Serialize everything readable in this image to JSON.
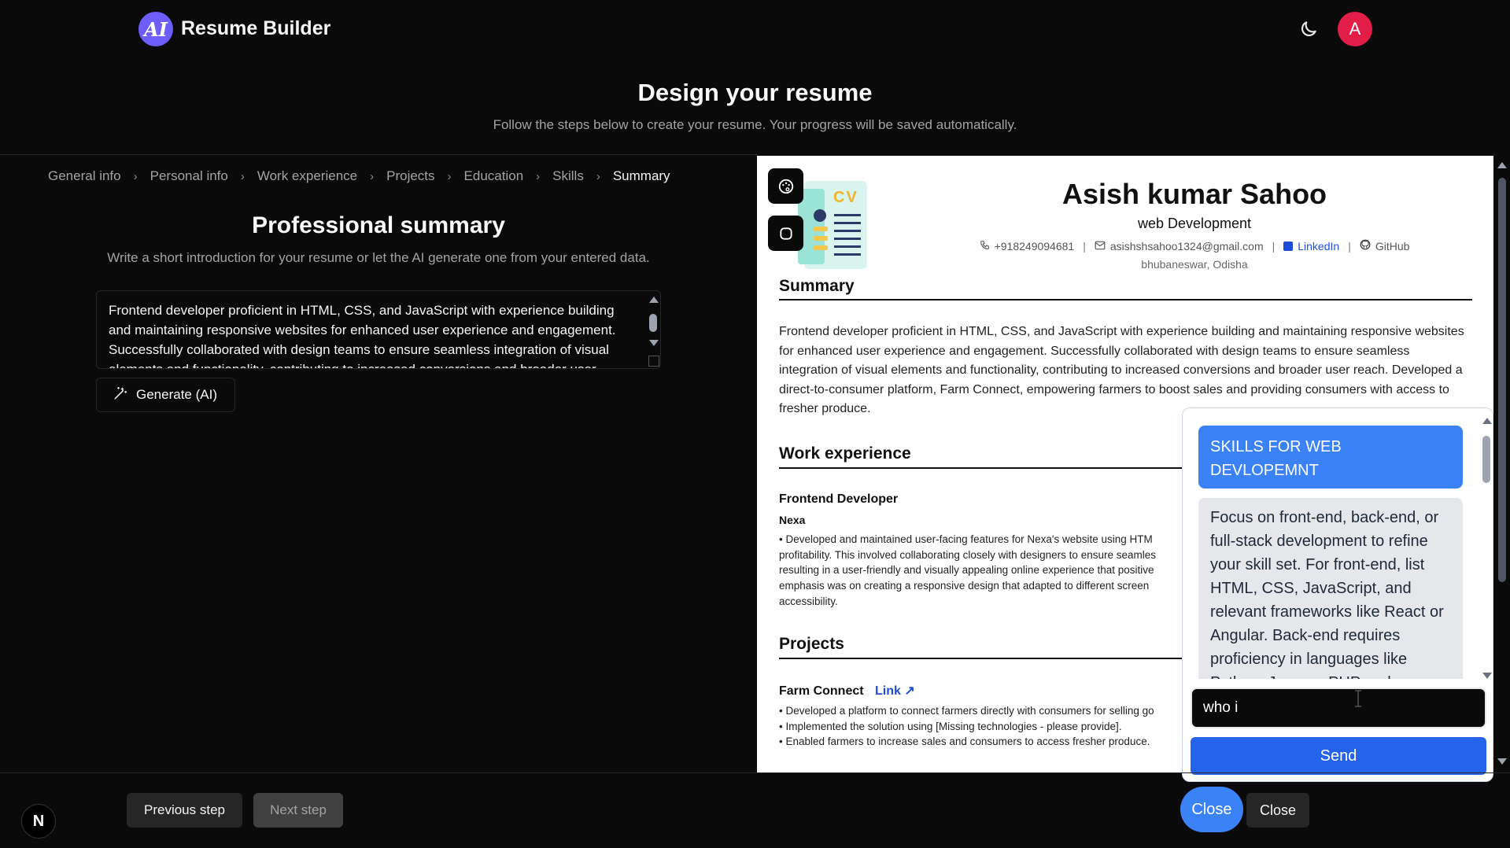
{
  "header": {
    "logo_text": "AI",
    "brand": "Resume Builder",
    "avatar_initial": "A"
  },
  "page": {
    "title": "Design your resume",
    "subtitle": "Follow the steps below to create your resume. Your progress will be saved automatically."
  },
  "breadcrumb": [
    "General info",
    "Personal info",
    "Work experience",
    "Projects",
    "Education",
    "Skills",
    "Summary"
  ],
  "summary_step": {
    "title": "Professional summary",
    "subtitle": "Write a short introduction for your resume or let the AI generate one from your entered data.",
    "textarea_value": "Frontend developer proficient in HTML, CSS, and JavaScript with experience building and maintaining responsive websites for enhanced user experience and engagement. Successfully collaborated with design teams to ensure seamless integration of visual elements and functionality, contributing to increased conversions and broader user reach.",
    "generate_label": "Generate (AI)"
  },
  "resume": {
    "cv_badge": "CV",
    "name": "Asish kumar Sahoo",
    "role": "web Development",
    "phone": "+918249094681",
    "email": "asishshsahoo1324@gmail.com",
    "linkedin": "LinkedIn",
    "github": "GitHub",
    "location": "bhubaneswar, Odisha",
    "summary_heading": "Summary",
    "summary_text": "Frontend developer proficient in HTML, CSS, and JavaScript with experience building and maintaining responsive websites for enhanced user experience and engagement. Successfully collaborated with design teams to ensure seamless integration of visual elements and functionality, contributing to increased conversions and broader user reach. Developed a direct-to-consumer platform, Farm Connect, empowering farmers to boost sales and providing consumers with access to fresher produce.",
    "work_heading": "Work experience",
    "job_title": "Frontend Developer",
    "company": "Nexa",
    "job_lines": [
      "• Developed and maintained user-facing features for Nexa's website using HTM",
      "profitability. This involved collaborating closely with designers to ensure seamles",
      "resulting in a user-friendly and visually appealing online experience that positive",
      "emphasis was on creating a responsive design that adapted to different screen",
      "accessibility."
    ],
    "projects_heading": "Projects",
    "project_title": "Farm Connect",
    "project_link": "Link ↗",
    "project_lines": [
      "• Developed a platform to connect farmers directly with consumers for selling go",
      "• Implemented the solution using [Missing technologies - please provide].",
      "• Enabled farmers to increase sales and consumers to access fresher produce."
    ]
  },
  "chat": {
    "user_message": "SKILLS FOR WEB DEVLOPEMNT",
    "bot_message": "Focus on front-end, back-end, or full-stack development to refine your skill set. For front-end, list HTML, CSS, JavaScript, and relevant frameworks like React or Angular. Back-end requires proficiency in languages like Python, Java, or PHP and",
    "input_value": "who i",
    "send_label": "Send"
  },
  "footer": {
    "next_logo": "N",
    "prev_label": "Previous step",
    "next_label": "Next step",
    "close_round_label": "Close",
    "close_flat_label": "Close"
  },
  "colors": {
    "accent_blue": "#3b82f6",
    "avatar_red": "#e11d48",
    "logo_purple": "#6d5dfc"
  }
}
